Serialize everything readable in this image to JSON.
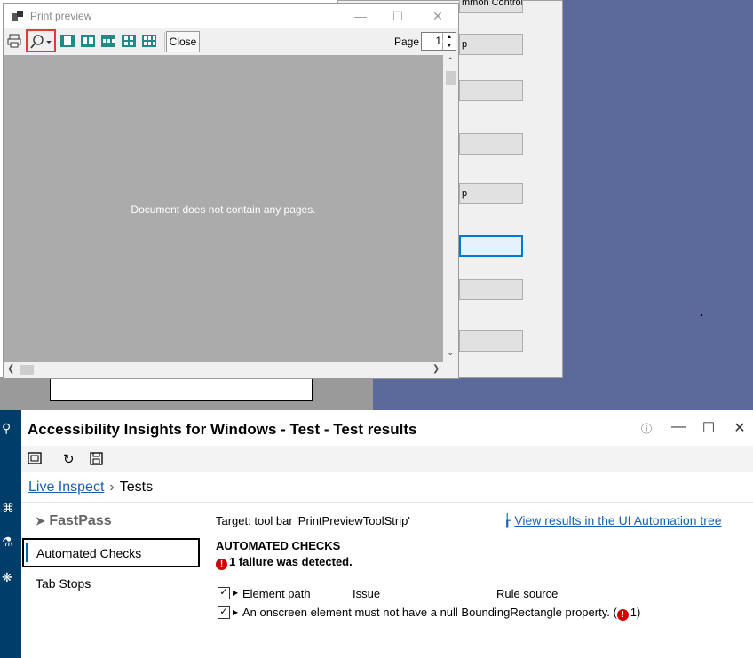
{
  "background_form": {
    "buttons": [
      "mmon Control Tip",
      "p",
      "",
      "",
      "p",
      "",
      "",
      ""
    ]
  },
  "print_preview": {
    "title": "Print preview",
    "toolbar": {
      "close_label": "Close",
      "page_label": "Page",
      "page_value": "1"
    },
    "message": "Document does not contain any pages."
  },
  "ai": {
    "title": "Accessibility Insights for Windows - Test - Test results",
    "breadcrumb": {
      "link": "Live Inspect",
      "current": "Tests"
    },
    "fastpass": "FastPass",
    "nav": {
      "automated": "Automated Checks",
      "tab_stops": "Tab Stops"
    },
    "target": "Target: tool bar 'PrintPreviewToolStrip'",
    "uia_link": "View results in the UI Automation tree",
    "heading": "AUTOMATED CHECKS",
    "failure_text": "1 failure was detected.",
    "columns": {
      "element_path": "Element path",
      "issue": "Issue",
      "rule_source": "Rule source"
    },
    "rule": {
      "text": "An onscreen element must not have a null BoundingRectangle property. (",
      "count": "1",
      "close": ")"
    }
  }
}
